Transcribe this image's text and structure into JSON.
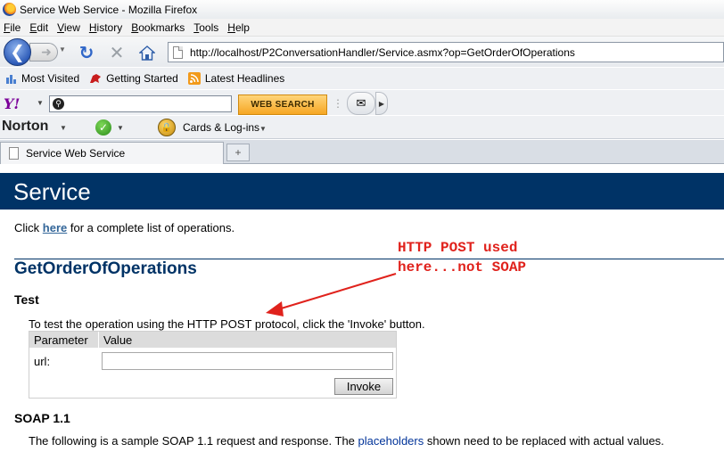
{
  "window": {
    "title": "Service Web Service - Mozilla Firefox"
  },
  "menu": [
    "File",
    "Edit",
    "View",
    "History",
    "Bookmarks",
    "Tools",
    "Help"
  ],
  "nav": {
    "url": "http://localhost/P2ConversationHandler/Service.asmx?op=GetOrderOfOperations"
  },
  "bookmarks": [
    {
      "label": "Most Visited",
      "icon": "most-visited-icon"
    },
    {
      "label": "Getting Started",
      "icon": "getting-started-icon"
    },
    {
      "label": "Latest Headlines",
      "icon": "rss-icon"
    }
  ],
  "yahoo": {
    "logo": "Y!",
    "search_value": "",
    "button": "WEB SEARCH"
  },
  "norton": {
    "logo": "Norton",
    "cards_label": "Cards & Log-ins"
  },
  "tabs": [
    {
      "label": "Service Web Service"
    }
  ],
  "page": {
    "banner": "Service",
    "intro_prefix": "Click ",
    "intro_link": "here",
    "intro_suffix": " for a complete list of operations.",
    "operation": "GetOrderOfOperations",
    "test_heading": "Test",
    "test_desc": "To test the operation using the HTTP POST protocol, click the 'Invoke' button.",
    "form": {
      "col_parameter": "Parameter",
      "col_value": "Value",
      "param_label": "url:",
      "param_value": "",
      "invoke": "Invoke"
    },
    "soap_heading": "SOAP 1.1",
    "soap_desc_prefix": "The following is a sample SOAP 1.1 request and response. The ",
    "soap_desc_link": "placeholders",
    "soap_desc_suffix": " shown need to be replaced with actual values."
  },
  "annotation": {
    "line1": "HTTP POST used",
    "line2": "here...not SOAP",
    "color": "#e0221c"
  },
  "colors": {
    "banner": "#003366",
    "accent": "#336699"
  }
}
